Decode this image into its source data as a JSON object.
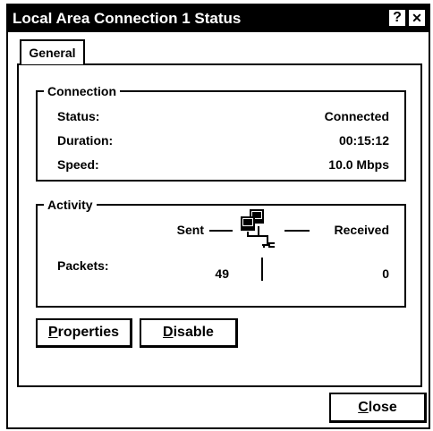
{
  "window": {
    "title": "Local Area Connection 1 Status",
    "help_label": "?",
    "close_label": "✕"
  },
  "tabs": [
    {
      "label": "General"
    }
  ],
  "connection": {
    "legend": "Connection",
    "rows": [
      {
        "label": "Status:",
        "value": "Connected"
      },
      {
        "label": "Duration:",
        "value": "00:15:12"
      },
      {
        "label": "Speed:",
        "value": "10.0 Mbps"
      }
    ]
  },
  "activity": {
    "legend": "Activity",
    "sent_label": "Sent",
    "received_label": "Received",
    "packets_label": "Packets:",
    "packets_sent": "49",
    "packets_received": "0",
    "icon": "network-computers-icon"
  },
  "buttons": {
    "properties": {
      "mnemonic": "P",
      "rest": "roperties"
    },
    "disable": {
      "mnemonic": "D",
      "rest": "isable"
    },
    "close": {
      "mnemonic": "C",
      "rest": "lose"
    }
  }
}
